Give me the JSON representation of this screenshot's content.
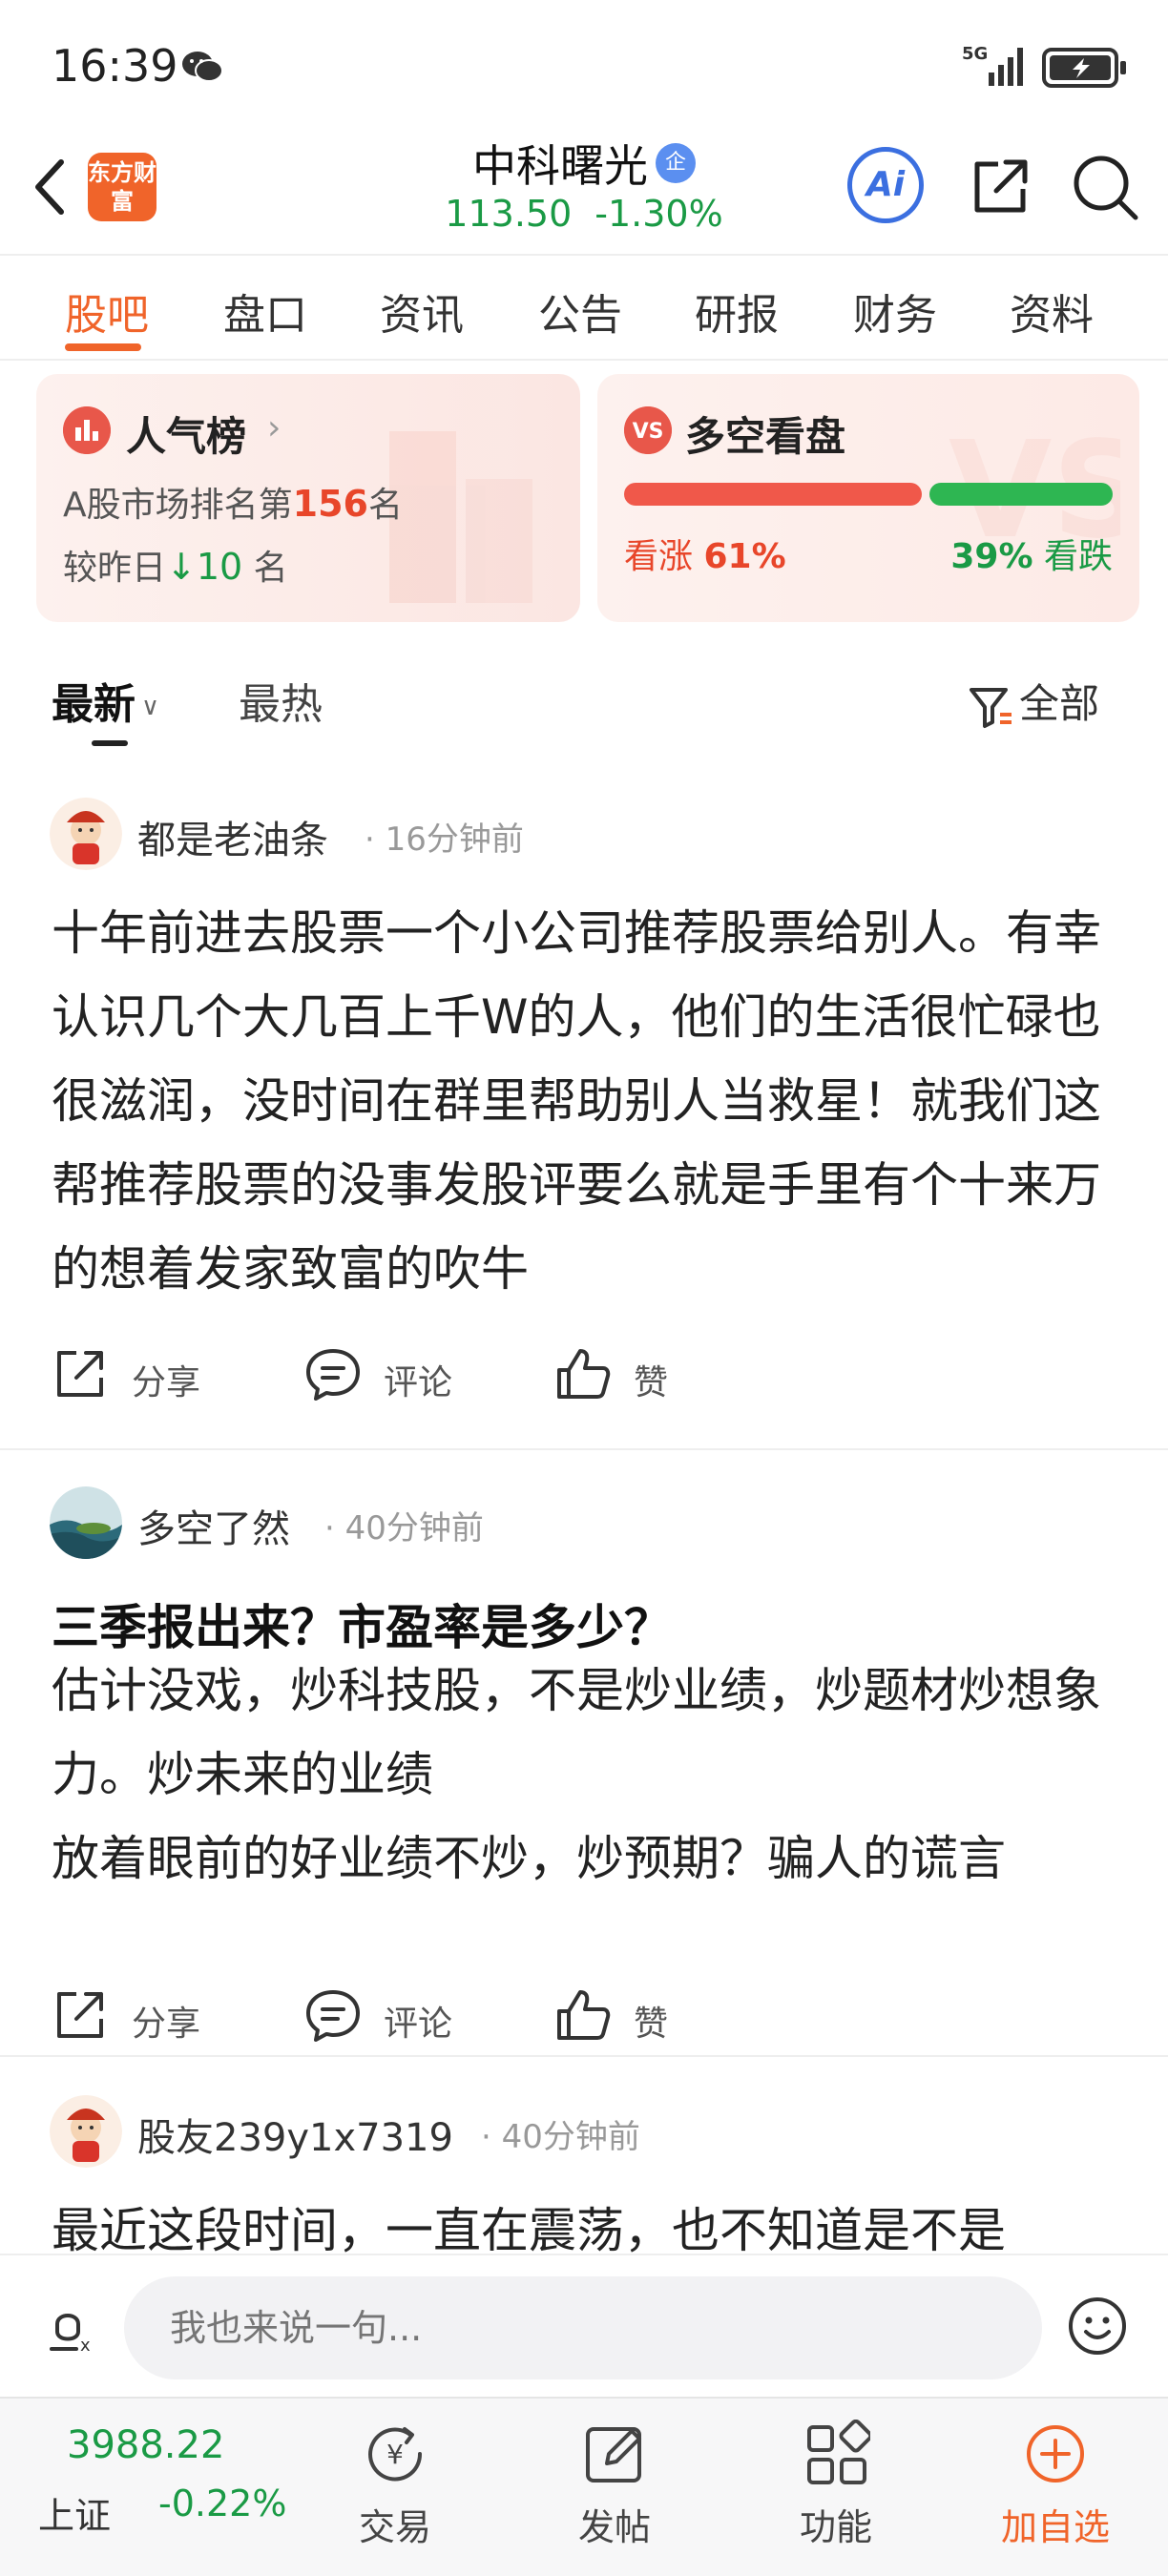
{
  "status": {
    "time": "16:39",
    "network": "5G"
  },
  "header": {
    "logo_text": "东方财富",
    "stock_name": "中科曙光",
    "badge": "企",
    "price": "113.50",
    "change": "-1.30%",
    "ai_label": "Ai"
  },
  "tabs": [
    {
      "label": "股吧",
      "active": true
    },
    {
      "label": "盘口"
    },
    {
      "label": "资讯"
    },
    {
      "label": "公告"
    },
    {
      "label": "研报"
    },
    {
      "label": "财务"
    },
    {
      "label": "资料"
    }
  ],
  "popularity": {
    "title": "人气榜",
    "rank_prefix": "A股市场排名第",
    "rank": "156",
    "rank_suffix": "名",
    "change_prefix": "较昨日",
    "change_arrow": "↓",
    "change_value": "10",
    "change_suffix": " 名"
  },
  "sentiment": {
    "title": "多空看盘",
    "bull_label": "看涨",
    "bull_pct": "61%",
    "bull_fraction": 0.61,
    "bear_label": "看跌",
    "bear_pct": "39%"
  },
  "sort": {
    "latest": "最新",
    "hot": "最热",
    "filter": "全部"
  },
  "posts": [
    {
      "author": "都是老油条",
      "time": "· 16分钟前",
      "title": "",
      "body": "十年前进去股票一个小公司推荐股票给别人。有幸认识几个大几百上千W的人，他们的生活很忙碌也很滋润，没时间在群里帮助别人当救星！就我们这帮推荐股票的没事发股评要么就是手里有个十来万的想着发家致富的吹牛",
      "share": "分享",
      "comment": "评论",
      "like": "赞"
    },
    {
      "author": "多空了然",
      "time": "· 40分钟前",
      "title": "三季报出来？市盈率是多少？",
      "body": "估计没戏，炒科技股，不是炒业绩，炒题材炒想象力。炒未来的业绩\n放着眼前的好业绩不炒，炒预期？骗人的谎言",
      "share": "分享",
      "comment": "评论",
      "like": "赞"
    },
    {
      "author": "股友239y1x7319",
      "time": "· 40分钟前",
      "title": "",
      "body": "最近这段时间，一直在震荡，也不知道是不是"
    }
  ],
  "comment_bar": {
    "placeholder": "我也来说一句..."
  },
  "bottom": {
    "index_value": "3988.22",
    "index_name": "上证",
    "index_change": "-0.22%",
    "nav": [
      "交易",
      "发帖",
      "功能",
      "加自选"
    ]
  },
  "colors": {
    "accent": "#f0642a",
    "down": "#1a9a45",
    "up": "#e8462a",
    "ai": "#3b6fe0"
  }
}
